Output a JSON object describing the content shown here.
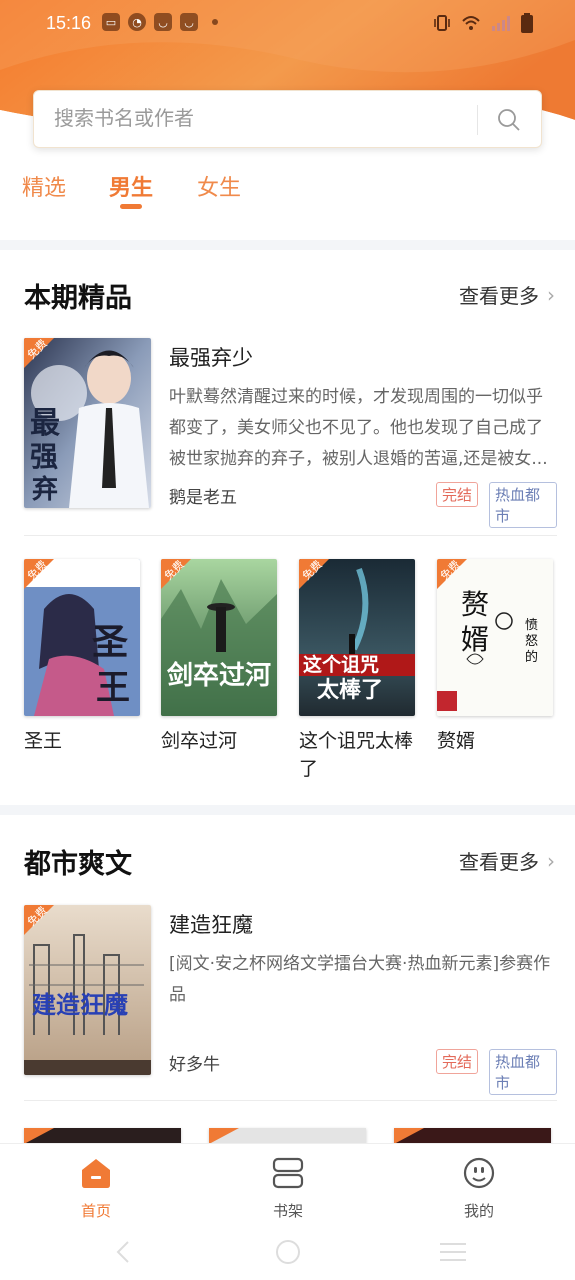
{
  "status_bar": {
    "time": "15:16"
  },
  "search": {
    "placeholder": "搜索书名或作者"
  },
  "tabs": [
    {
      "label": "精选",
      "active": false
    },
    {
      "label": "男生",
      "active": true
    },
    {
      "label": "女生",
      "active": false
    }
  ],
  "sections": [
    {
      "title": "本期精品",
      "more": "查看更多",
      "featured": {
        "title": "最强弃少",
        "description": "叶默蓦然清醒过来的时候，才发现周围的一切似乎都变了，美女师父也不见了。他也发现了自己成了被世家抛弃的弃子，被别人退婚的苦逼,还是被女...",
        "author": "鹅是老五",
        "status_tag": "完结",
        "category_tag": "热血都市",
        "badge": "免费"
      },
      "grid": [
        {
          "title": "圣王",
          "badge": "免费"
        },
        {
          "title": "剑卒过河",
          "badge": "免费"
        },
        {
          "title": "这个诅咒太棒了",
          "badge": "免费"
        },
        {
          "title": "赘婿",
          "badge": "免费"
        }
      ]
    },
    {
      "title": "都市爽文",
      "more": "查看更多",
      "featured": {
        "title": "建造狂魔",
        "description": "[阅文·安之杯网络文学擂台大赛·热血新元素]参赛作品",
        "author": "好多牛",
        "status_tag": "完结",
        "category_tag": "热血都市",
        "badge": "免费"
      }
    }
  ],
  "bottom_nav": [
    {
      "label": "首页",
      "icon": "home-icon",
      "active": true
    },
    {
      "label": "书架",
      "icon": "bookshelf-icon",
      "active": false
    },
    {
      "label": "我的",
      "icon": "profile-icon",
      "active": false
    }
  ],
  "colors": {
    "accent": "#f07a35",
    "header": "#f08a3a"
  }
}
